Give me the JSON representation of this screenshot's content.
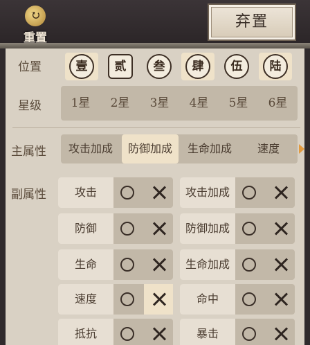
{
  "header": {
    "reset_label": "重置",
    "abandon_label": "弃置"
  },
  "position": {
    "label": "位置",
    "slots": [
      "壹",
      "贰",
      "叁",
      "肆",
      "伍",
      "陆"
    ],
    "selected": [
      0,
      3,
      5
    ]
  },
  "star": {
    "label": "星级",
    "options": [
      "1星",
      "2星",
      "3星",
      "4星",
      "5星",
      "6星"
    ]
  },
  "main_attr": {
    "label": "主属性",
    "options": [
      "攻击加成",
      "防御加成",
      "生命加成",
      "速度"
    ],
    "selected_index": 1
  },
  "sub_attr": {
    "label": "副属性",
    "items": [
      {
        "name": "攻击",
        "cross_selected": false
      },
      {
        "name": "攻击加成",
        "cross_selected": false
      },
      {
        "name": "防御",
        "cross_selected": false
      },
      {
        "name": "防御加成",
        "cross_selected": false
      },
      {
        "name": "生命",
        "cross_selected": false
      },
      {
        "name": "生命加成",
        "cross_selected": false
      },
      {
        "name": "速度",
        "cross_selected": true
      },
      {
        "name": "命中",
        "cross_selected": false
      },
      {
        "name": "抵抗",
        "cross_selected": false
      },
      {
        "name": "暴击",
        "cross_selected": false
      }
    ]
  },
  "icons": {
    "include": "circle-icon",
    "exclude": "cross-icon",
    "more": "arrow-right-icon"
  },
  "colors": {
    "accent": "#e29a3e",
    "selected": "#efe2c9"
  }
}
